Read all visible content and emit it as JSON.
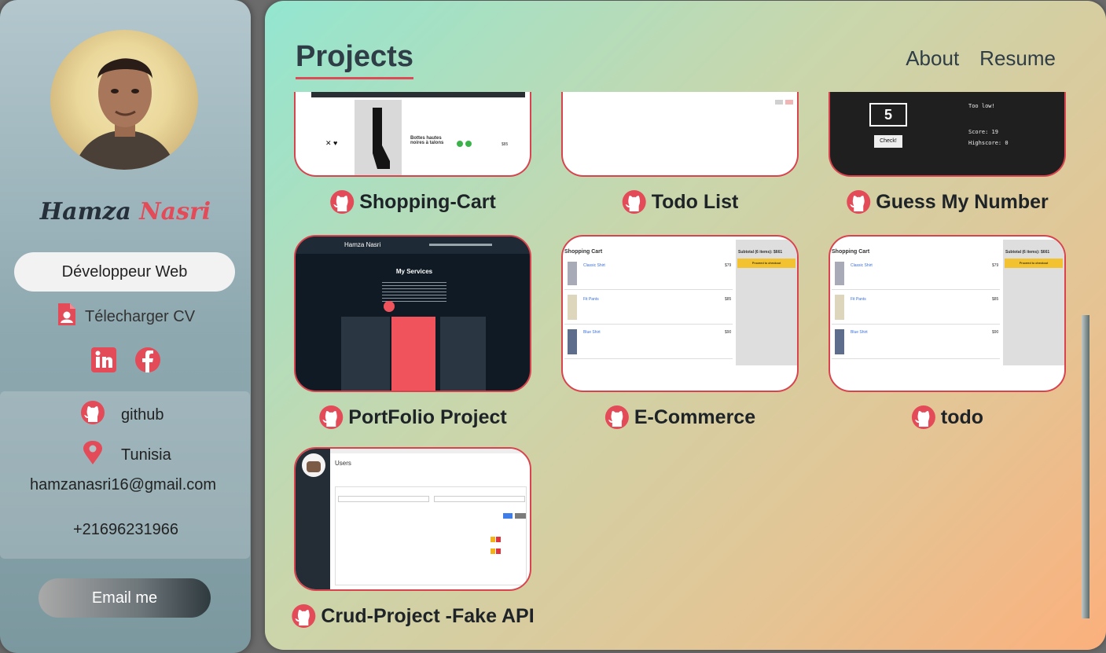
{
  "profile": {
    "first_name": "Hamza",
    "last_name": "Nasri",
    "role": "Développeur Web",
    "cv_label": "Télecharger CV",
    "github_label": "github",
    "location": "Tunisia",
    "email": "hamzanasri16@gmail.com",
    "phone": "+21696231966",
    "email_button": "Email me"
  },
  "header": {
    "title": "Projects",
    "nav": [
      "About",
      "Resume"
    ]
  },
  "projects": [
    {
      "name": "Shopping-Cart"
    },
    {
      "name": "Todo List"
    },
    {
      "name": "Guess My Number"
    },
    {
      "name": "PortFolio Project"
    },
    {
      "name": "E-Commerce"
    },
    {
      "name": "todo"
    },
    {
      "name": "Crud-Project -Fake API"
    }
  ],
  "thumbs": {
    "guess_number": "5",
    "guess_check": "Check!",
    "guess_hint": "Too low!",
    "guess_score": "Score: 19",
    "guess_highscore": "Highscore: 0",
    "portfolio_brand": "Hamza Nasri",
    "portfolio_heading": "My Services",
    "shop_title": "Shopping Cart",
    "shop_subtotal": "Subtotal (6 items): $661",
    "shop_checkout": "Proceed to checkout",
    "shop_items": [
      "Classic Shirt",
      "Fit Pants",
      "Blue Shirt"
    ],
    "shop_prices": [
      "$79",
      "$85",
      "$90"
    ],
    "boot_name": "Bottes hautes noires à talons",
    "crud_title": "Users"
  },
  "colors": {
    "accent": "#e04a57",
    "text_dark": "#2f3d47"
  }
}
